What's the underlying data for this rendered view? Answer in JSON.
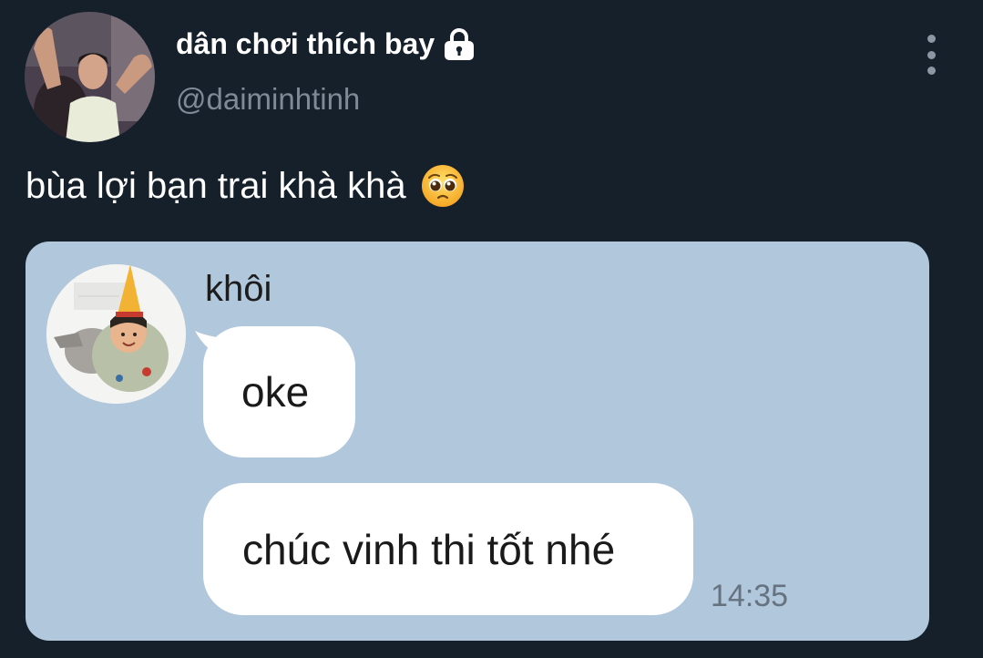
{
  "profile": {
    "display_name": "dân chơi thích bay",
    "handle": "@daiminhtinh",
    "avatar_icon": "profile-photo",
    "protected_icon": "lock-icon"
  },
  "tweet": {
    "text": "bùa lợi bạn trai khà khà",
    "emoji_icon": "pleading-face-emoji"
  },
  "menu": {
    "icon": "more-vertical-icon"
  },
  "chat": {
    "background": "#b1c7dc",
    "sender_name": "khôi",
    "avatar_icon": "party-hat-child-photo",
    "messages": [
      {
        "text": "oke"
      },
      {
        "text": "chúc vinh thi tốt nhé"
      }
    ],
    "timestamp": "14:35"
  },
  "colors": {
    "background": "#16202b",
    "handle": "#7f8a96",
    "bubble": "#ffffff"
  }
}
